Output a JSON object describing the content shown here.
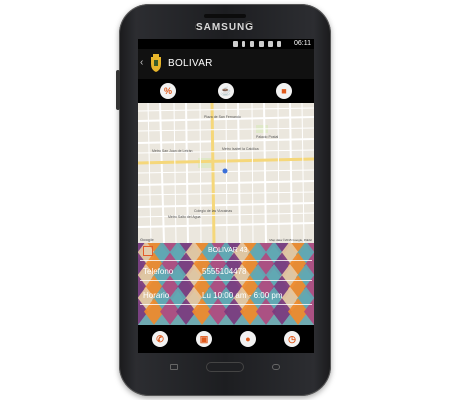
{
  "device": {
    "brand": "SAMSUNG"
  },
  "status_bar": {
    "time": "06:11",
    "icons": [
      "location-icon",
      "vibrate-icon",
      "bluetooth-icon",
      "wifi-icon",
      "signal-icon",
      "battery-icon"
    ]
  },
  "action_bar": {
    "title": "BOLIVAR",
    "back_icon": "chevron-left-icon",
    "logo_icon": "crest-logo-icon"
  },
  "top_actions": [
    {
      "name": "promotions-button",
      "icon": "percent-icon",
      "glyph": "%"
    },
    {
      "name": "menu-button",
      "icon": "drink-icon",
      "glyph": "☕"
    },
    {
      "name": "delivery-button",
      "icon": "car-icon",
      "glyph": "■"
    }
  ],
  "map": {
    "labels": [
      "Metro San Juan de Letrán",
      "Metro Salto del Agua",
      "Metro Isabel la Católica",
      "Plaza de San Fernando",
      "Colegio de las Vizcainas",
      "Palacio Postal"
    ],
    "attribution": "Map data ©2015 Google, INEGI",
    "provider": "Google"
  },
  "info": {
    "place_name": "BOLIVAR 43",
    "phone_label": "Telefono",
    "phone_value": "5555104478",
    "hours_label": "Horario",
    "hours_value": "Lu 10:00 am - 6:00 pm"
  },
  "bottom_actions": [
    {
      "name": "call-button",
      "icon": "phone-icon",
      "glyph": "✆"
    },
    {
      "name": "store-button",
      "icon": "briefcase-icon",
      "glyph": "▣"
    },
    {
      "name": "ball-button",
      "icon": "ball-icon",
      "glyph": "●"
    },
    {
      "name": "clock-button",
      "icon": "clock-icon",
      "glyph": "◷"
    }
  ],
  "colors": {
    "accent": "#e05a1c",
    "pattern_purple": "#7b3a7e",
    "pattern_teal": "#5fa8b3",
    "pattern_orange": "#f08a2a",
    "pattern_beige": "#e7c9a2",
    "pattern_magenta": "#b04a7f"
  }
}
